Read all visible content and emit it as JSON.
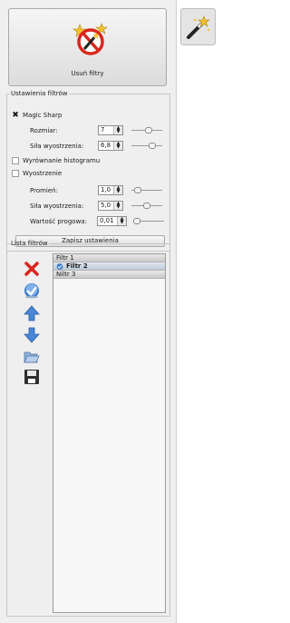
{
  "remove_filters_button": {
    "label": "Usuń filtry",
    "icon": "magic-wand-remove-icon"
  },
  "side_tool_button": {
    "icon": "magic-wand-icon"
  },
  "settings": {
    "legend": "Ustawienia filtrów",
    "magic_sharp": {
      "label": "Magic Sharp",
      "checked": true
    },
    "rozmiar": {
      "label": "Rozmiar:",
      "value": "7",
      "slider_fraction": 0.55
    },
    "sila_1": {
      "label": "Siła wyostrzenia:",
      "value": "6,8",
      "slider_fraction": 0.7
    },
    "histogram": {
      "label": "Wyrównanie histogramu",
      "checked": false
    },
    "wyostrzenie": {
      "label": "Wyostrzenie",
      "checked": false
    },
    "promien": {
      "label": "Promień:",
      "value": "1,0",
      "slider_fraction": 0.05
    },
    "sila_2": {
      "label": "Siła wyostrzenia:",
      "value": "5,0",
      "slider_fraction": 0.5
    },
    "prog": {
      "label": "Wartość progowa:",
      "value": "0,01",
      "slider_fraction": 0.0
    },
    "save_label": "Zapisz ustawienia"
  },
  "filters": {
    "legend": "Lista filtrów",
    "tools": [
      "delete-icon",
      "checkmark-icon",
      "arrow-up-icon",
      "arrow-down-icon",
      "open-folder-icon",
      "save-icon"
    ],
    "items": [
      {
        "label": "Filtr 1",
        "active": false
      },
      {
        "label": "Filtr 2",
        "active": true
      },
      {
        "label": "Niltr 3",
        "active": false
      }
    ]
  },
  "colors": {
    "accent_blue": "#3a78c8",
    "delete_red": "#d8261d"
  }
}
